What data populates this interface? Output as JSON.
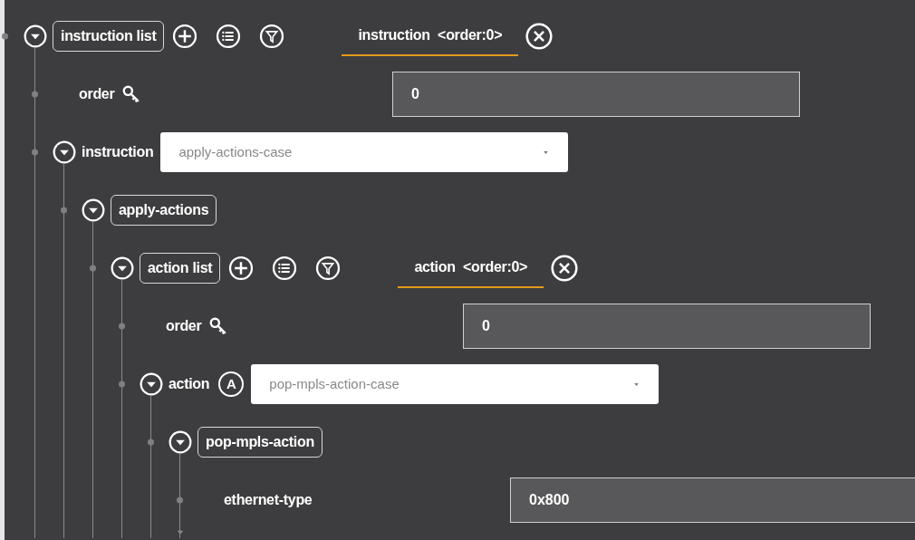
{
  "tree": {
    "kind": "list",
    "label": "instruction list",
    "expanded": true,
    "entry_tab": {
      "label": "instruction <order:0>",
      "selected": true
    },
    "children": [
      {
        "kind": "leaf",
        "label": "order",
        "key": true,
        "value": "0"
      },
      {
        "kind": "choice",
        "label": "instruction",
        "expanded": true,
        "select": "apply-actions-case",
        "children": [
          {
            "kind": "container",
            "label": "apply-actions",
            "expanded": true,
            "children": [
              {
                "kind": "list",
                "label": "action list",
                "expanded": true,
                "entry_tab": {
                  "label": "action <order:0>",
                  "selected": true
                },
                "children": [
                  {
                    "kind": "leaf",
                    "label": "order",
                    "key": true,
                    "value": "0"
                  },
                  {
                    "kind": "choice",
                    "label": "action",
                    "badge": "A",
                    "expanded": true,
                    "select": "pop-mpls-action-case",
                    "children": [
                      {
                        "kind": "container",
                        "label": "pop-mpls-action",
                        "expanded": true,
                        "children": [
                          {
                            "kind": "leaf",
                            "label": "ethernet-type",
                            "key": false,
                            "value": "0x800"
                          }
                        ]
                      }
                    ]
                  }
                ]
              }
            ]
          }
        ]
      }
    ]
  }
}
